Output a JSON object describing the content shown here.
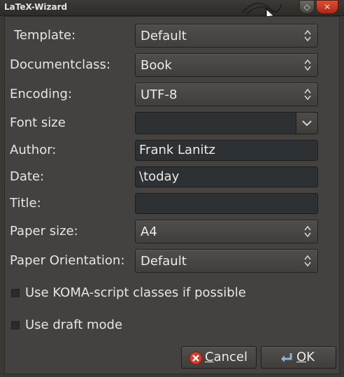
{
  "window": {
    "title": "LaTeX-Wizard"
  },
  "form": {
    "template": {
      "label": "Template:",
      "value": "Default"
    },
    "documentclass": {
      "label": "Documentclass:",
      "value": "Book"
    },
    "encoding": {
      "label": "Encoding:",
      "value": "UTF-8"
    },
    "font_size": {
      "label": "Font size",
      "value": ""
    },
    "author": {
      "label": "Author:",
      "value": "Frank Lanitz"
    },
    "date": {
      "label": "Date:",
      "value": "\\today"
    },
    "title": {
      "label": "Title:",
      "value": ""
    },
    "paper_size": {
      "label": "Paper size:",
      "value": "A4"
    },
    "paper_orientation": {
      "label": "Paper Orientation:",
      "value": "Default"
    }
  },
  "options": {
    "koma": {
      "label": "Use KOMA-script classes if possible",
      "checked": false
    },
    "draft": {
      "label": "Use draft mode",
      "checked": false
    }
  },
  "buttons": {
    "cancel": {
      "mnemonic": "C",
      "rest": "ancel"
    },
    "ok": {
      "mnemonic": "O",
      "rest": "K"
    }
  },
  "colors": {
    "cancel_icon": "#d83a2a",
    "ok_icon": "#8fb3d9"
  }
}
